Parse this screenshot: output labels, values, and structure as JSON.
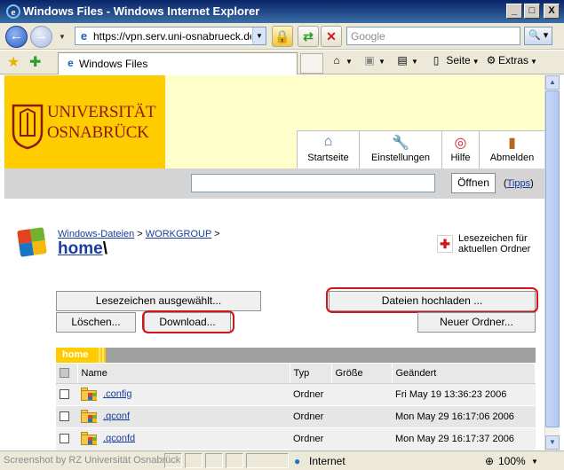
{
  "window": {
    "title": "Windows Files - Windows Internet Explorer",
    "min_label": "_",
    "max_label": "□",
    "close_label": "X"
  },
  "addressbar": {
    "url": "https://vpn.serv.uni-osnabrueck.de/(",
    "search_placeholder": "Google",
    "go_label": "🔍"
  },
  "tabbar": {
    "tab_label": "Windows Files",
    "seite_label": "Seite",
    "extras_label": "Extras"
  },
  "header": {
    "logo_line1": "UNIVERSITÄT",
    "logo_line2": "OSNABRÜCK",
    "nav": [
      {
        "label": "Startseite",
        "icon": "home-icon"
      },
      {
        "label": "Einstellungen",
        "icon": "wrench-icon"
      },
      {
        "label": "Hilfe",
        "icon": "lifebuoy-icon"
      },
      {
        "label": "Abmelden",
        "icon": "door-icon"
      }
    ]
  },
  "search": {
    "value": "",
    "open_label": "Öffnen",
    "tips_open": "(",
    "tips_label": "Tipps",
    "tips_close": ")"
  },
  "breadcrumb": {
    "part1": "Windows-Dateien",
    "sep1": " > ",
    "part2": "WORKGROUP",
    "sep2": " >"
  },
  "page_title": {
    "name": "home",
    "slash": "\\"
  },
  "bookmark": {
    "line1": "Lesezeichen für",
    "line2": "aktuellen Ordner"
  },
  "actions": {
    "bookmark_selected": "Lesezeichen ausgewählt...",
    "upload": "Dateien hochladen ...",
    "delete": "Löschen...",
    "download": "Download...",
    "new_folder": "Neuer Ordner..."
  },
  "table": {
    "tab_label": "home",
    "headers": [
      "Name",
      "Typ",
      "Größe",
      "Geändert"
    ],
    "rows": [
      {
        "name": ".config",
        "type": "Ordner",
        "size": "",
        "modified": "Fri May 19 13:36:23 2006"
      },
      {
        "name": ".qconf",
        "type": "Ordner",
        "size": "",
        "modified": "Mon May 29 16:17:06 2006"
      },
      {
        "name": ".qconfd",
        "type": "Ordner",
        "size": "",
        "modified": "Mon May 29 16:17:37 2006"
      }
    ]
  },
  "statusbar": {
    "watermark": "Screenshot by RZ Universität Osnabrück",
    "zone": "Internet",
    "zoom": "100%"
  },
  "colors": {
    "uni_yellow": "#ffcc00",
    "uni_red": "#8b1a1a",
    "highlight_ring": "#d4141a",
    "link_blue": "#1a3d9e"
  }
}
